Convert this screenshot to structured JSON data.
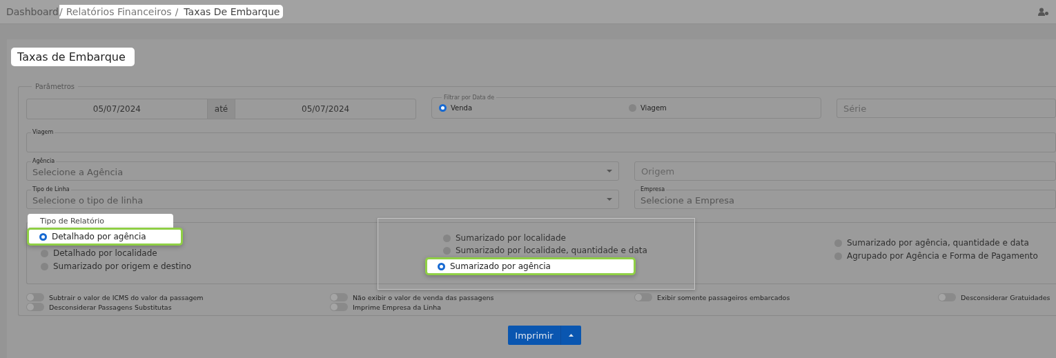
{
  "breadcrumb": [
    {
      "label": "Dashboard",
      "highlighted": false
    },
    {
      "label": "Relatórios Financeiros",
      "separator": "/",
      "highlighted": true
    },
    {
      "label": "Taxas De Embarque",
      "separator": "/",
      "highlighted": true
    }
  ],
  "page_title": {
    "text": "Taxas de Embarque",
    "highlighted": true
  },
  "parameters": {
    "legend": "Parâmetros",
    "date_from": "05/07/2024",
    "date_joiner": "até",
    "date_to": "05/07/2024",
    "date_filter": {
      "legend": "Filtrar por Data de",
      "options": [
        {
          "label": "Venda",
          "selected": true
        },
        {
          "label": "Viagem",
          "selected": false
        }
      ]
    },
    "serie": {
      "placeholder": "Série"
    },
    "viagem": {
      "label": "Viagem"
    },
    "agencia": {
      "label": "Agência",
      "placeholder": "Selecione a Agência"
    },
    "origem": {
      "placeholder": "Origem"
    },
    "tipo_linha": {
      "label": "Tipo de Linha",
      "placeholder": "Selecione o tipo de linha"
    },
    "empresa": {
      "label": "Empresa",
      "placeholder": "Selecione a Empresa"
    },
    "report_type": {
      "legend": "Tipo de Relatório",
      "legend_highlighted": true,
      "columns": [
        {
          "highlighted": false,
          "options": [
            {
              "label": "Detalhado por agência",
              "selected": true,
              "highlighted": true
            },
            {
              "label": "Detalhado por localidade",
              "selected": false,
              "highlighted": false
            },
            {
              "label": "Sumarizado por origem e destino",
              "selected": false,
              "highlighted": false
            }
          ]
        },
        {
          "highlighted": true,
          "options": [
            {
              "label": "Sumarizado por localidade",
              "selected": false,
              "highlighted": false
            },
            {
              "label": "Sumarizado por localidade, quantidade e data",
              "selected": false,
              "highlighted": false
            },
            {
              "label": "Sumarizado por agência",
              "selected": true,
              "highlighted": true
            }
          ]
        },
        {
          "highlighted": false,
          "options": [
            {
              "label": "Sumarizado por agência, quantidade e data",
              "selected": false,
              "highlighted": false
            },
            {
              "label": "Agrupado por Agência e Forma de Pagamento",
              "selected": false,
              "highlighted": false
            }
          ]
        }
      ]
    },
    "toggle_columns": [
      [
        {
          "label": "Subtrair o valor de ICMS do valor da passagem",
          "on": false
        },
        {
          "label": "Desconsiderar Passagens Substitutas",
          "on": false
        }
      ],
      [
        {
          "label": "Não exibir o valor de venda das passagens",
          "on": false
        },
        {
          "label": "Imprime Empresa da Linha",
          "on": false
        }
      ],
      [
        {
          "label": "Exibir somente passageiros embarcados",
          "on": false
        }
      ],
      [
        {
          "label": "Desconsiderar Gratuidades",
          "on": false
        }
      ]
    ]
  },
  "print_button": {
    "label": "Imprimir"
  }
}
